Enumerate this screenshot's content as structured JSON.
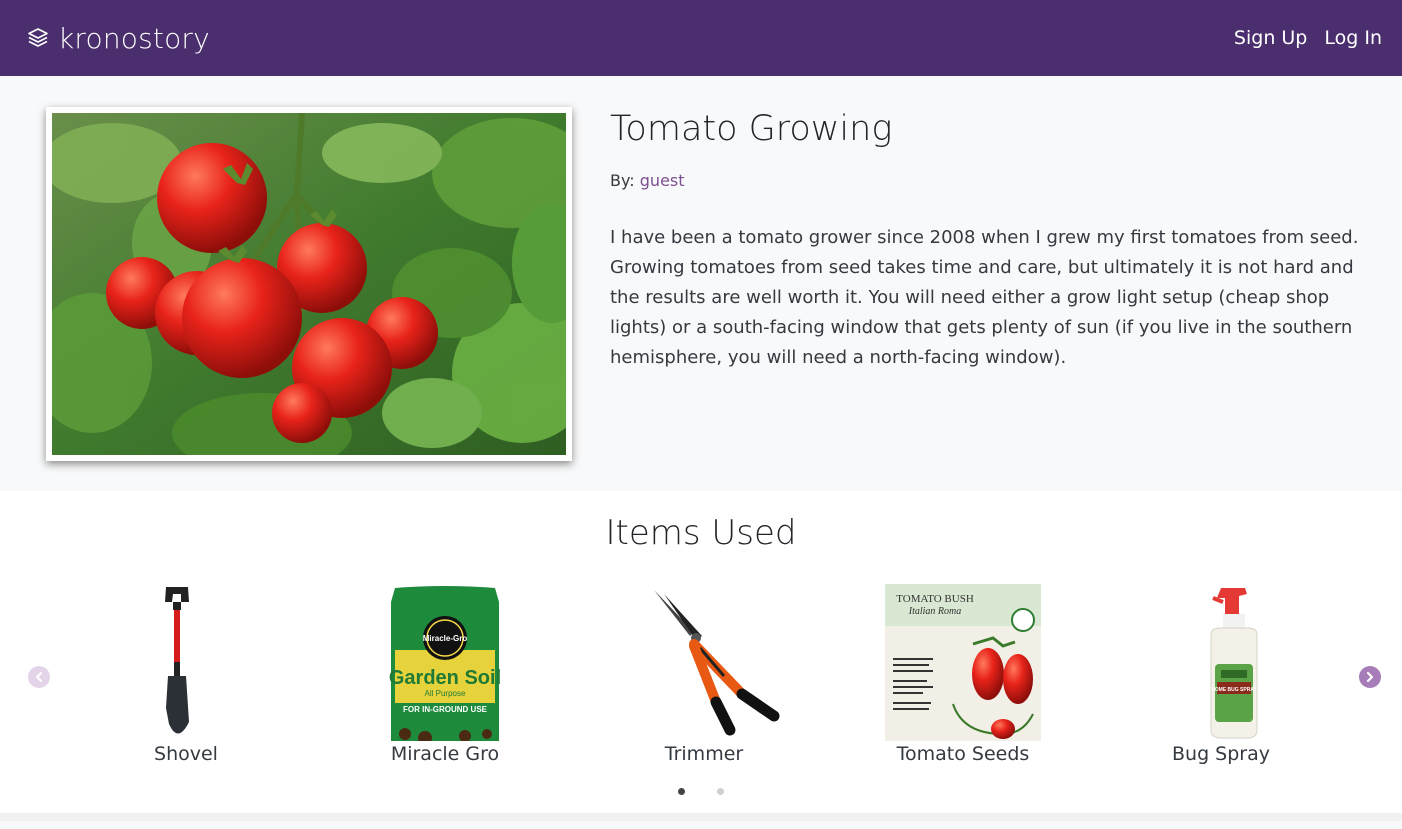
{
  "navbar": {
    "brand": "kronostory",
    "sign_up": "Sign Up",
    "log_in": "Log In"
  },
  "story": {
    "title": "Tomato Growing",
    "by_label": "By:",
    "author": "guest",
    "body": "I have been a tomato grower since 2008 when I grew my first tomatoes from seed. Growing tomatoes from seed takes time and care, but ultimately it is not hard and the results are well worth it. You will need either a grow light setup (cheap shop lights) or a south-facing window that gets plenty of sun (if you live in the southern hemisphere, you will need a north-facing window)."
  },
  "items_section": {
    "title": "Items Used",
    "items": [
      {
        "label": "Shovel"
      },
      {
        "label": "Miracle Gro"
      },
      {
        "label": "Trimmer"
      },
      {
        "label": "Tomato Seeds"
      },
      {
        "label": "Bug Spray"
      }
    ],
    "miracle_gro_pack": {
      "brand": "Miracle-Gro",
      "product": "Garden Soil",
      "subtitle": "All Purpose",
      "use": "FOR IN-GROUND USE"
    },
    "seed_pack": {
      "name": "TOMATO BUSH",
      "variety": "Italian Roma"
    },
    "bug_spray_label": "HOME BUG SPRAY",
    "page_count": 2,
    "active_page": 1
  },
  "colors": {
    "navbar": "#4b2e6e",
    "accent": "#7d4f8f",
    "arrow_active": "#a77db9",
    "arrow_inactive": "#e3d4ea"
  },
  "icons": {
    "brand": "layers-icon",
    "prev": "chevron-left-icon",
    "next": "chevron-right-icon"
  }
}
